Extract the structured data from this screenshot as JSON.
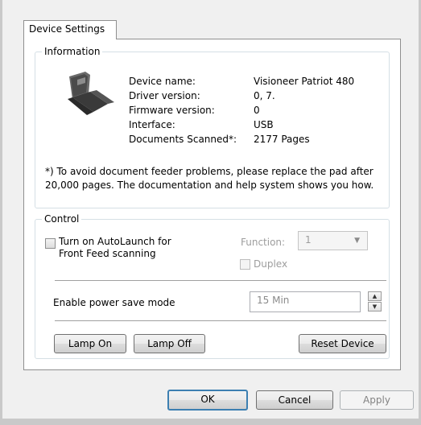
{
  "tabs": [
    {
      "label": "Device Settings"
    }
  ],
  "information": {
    "legend": "Information",
    "device_icon": "scanner-icon",
    "rows": [
      {
        "label": "Device name:",
        "value": "Visioneer Patriot 480"
      },
      {
        "label": "Driver version:",
        "value": "0, 7."
      },
      {
        "label": "Firmware version:",
        "value": "0"
      },
      {
        "label": "Interface:",
        "value": "USB"
      },
      {
        "label": "Documents Scanned*:",
        "value": "2177 Pages"
      }
    ],
    "note": "*) To avoid document feeder problems, please replace the pad after 20,000 pages. The documentation and help system shows you how."
  },
  "control": {
    "legend": "Control",
    "autolaunch_label": "Turn on AutoLaunch for\nFront Feed scanning",
    "autolaunch_checked": false,
    "function_label": "Function:",
    "function_value": "1",
    "duplex_label": "Duplex",
    "power_save_label": "Enable power save mode",
    "power_save_value": "15 Min",
    "lamp_on": "Lamp On",
    "lamp_off": "Lamp Off",
    "reset_device": "Reset Device"
  },
  "footer": {
    "ok": "OK",
    "cancel": "Cancel",
    "apply": "Apply"
  },
  "colors": {
    "default_button_border": "#3c7fb1",
    "disabled_text": "#9d9d9d"
  }
}
